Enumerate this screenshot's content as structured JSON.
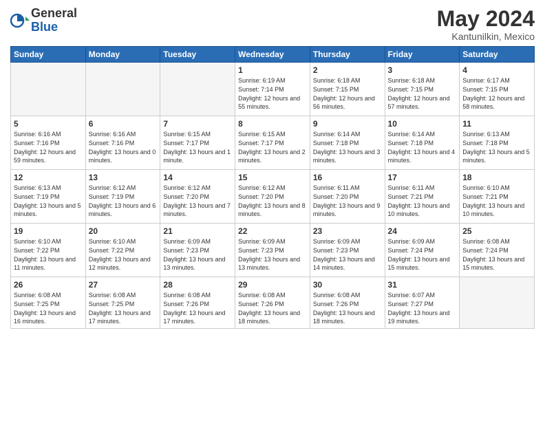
{
  "header": {
    "logo_general": "General",
    "logo_blue": "Blue",
    "title": "May 2024",
    "subtitle": "Kantunilkin, Mexico"
  },
  "weekdays": [
    "Sunday",
    "Monday",
    "Tuesday",
    "Wednesday",
    "Thursday",
    "Friday",
    "Saturday"
  ],
  "weeks": [
    [
      {
        "day": "",
        "empty": true
      },
      {
        "day": "",
        "empty": true
      },
      {
        "day": "",
        "empty": true
      },
      {
        "day": "1",
        "sunrise": "6:19 AM",
        "sunset": "7:14 PM",
        "daylight": "12 hours and 55 minutes."
      },
      {
        "day": "2",
        "sunrise": "6:18 AM",
        "sunset": "7:15 PM",
        "daylight": "12 hours and 56 minutes."
      },
      {
        "day": "3",
        "sunrise": "6:18 AM",
        "sunset": "7:15 PM",
        "daylight": "12 hours and 57 minutes."
      },
      {
        "day": "4",
        "sunrise": "6:17 AM",
        "sunset": "7:15 PM",
        "daylight": "12 hours and 58 minutes."
      }
    ],
    [
      {
        "day": "5",
        "sunrise": "6:16 AM",
        "sunset": "7:16 PM",
        "daylight": "12 hours and 59 minutes."
      },
      {
        "day": "6",
        "sunrise": "6:16 AM",
        "sunset": "7:16 PM",
        "daylight": "13 hours and 0 minutes."
      },
      {
        "day": "7",
        "sunrise": "6:15 AM",
        "sunset": "7:17 PM",
        "daylight": "13 hours and 1 minute."
      },
      {
        "day": "8",
        "sunrise": "6:15 AM",
        "sunset": "7:17 PM",
        "daylight": "13 hours and 2 minutes."
      },
      {
        "day": "9",
        "sunrise": "6:14 AM",
        "sunset": "7:18 PM",
        "daylight": "13 hours and 3 minutes."
      },
      {
        "day": "10",
        "sunrise": "6:14 AM",
        "sunset": "7:18 PM",
        "daylight": "13 hours and 4 minutes."
      },
      {
        "day": "11",
        "sunrise": "6:13 AM",
        "sunset": "7:18 PM",
        "daylight": "13 hours and 5 minutes."
      }
    ],
    [
      {
        "day": "12",
        "sunrise": "6:13 AM",
        "sunset": "7:19 PM",
        "daylight": "13 hours and 5 minutes."
      },
      {
        "day": "13",
        "sunrise": "6:12 AM",
        "sunset": "7:19 PM",
        "daylight": "13 hours and 6 minutes."
      },
      {
        "day": "14",
        "sunrise": "6:12 AM",
        "sunset": "7:20 PM",
        "daylight": "13 hours and 7 minutes."
      },
      {
        "day": "15",
        "sunrise": "6:12 AM",
        "sunset": "7:20 PM",
        "daylight": "13 hours and 8 minutes."
      },
      {
        "day": "16",
        "sunrise": "6:11 AM",
        "sunset": "7:20 PM",
        "daylight": "13 hours and 9 minutes."
      },
      {
        "day": "17",
        "sunrise": "6:11 AM",
        "sunset": "7:21 PM",
        "daylight": "13 hours and 10 minutes."
      },
      {
        "day": "18",
        "sunrise": "6:10 AM",
        "sunset": "7:21 PM",
        "daylight": "13 hours and 10 minutes."
      }
    ],
    [
      {
        "day": "19",
        "sunrise": "6:10 AM",
        "sunset": "7:22 PM",
        "daylight": "13 hours and 11 minutes."
      },
      {
        "day": "20",
        "sunrise": "6:10 AM",
        "sunset": "7:22 PM",
        "daylight": "13 hours and 12 minutes."
      },
      {
        "day": "21",
        "sunrise": "6:09 AM",
        "sunset": "7:23 PM",
        "daylight": "13 hours and 13 minutes."
      },
      {
        "day": "22",
        "sunrise": "6:09 AM",
        "sunset": "7:23 PM",
        "daylight": "13 hours and 13 minutes."
      },
      {
        "day": "23",
        "sunrise": "6:09 AM",
        "sunset": "7:23 PM",
        "daylight": "13 hours and 14 minutes."
      },
      {
        "day": "24",
        "sunrise": "6:09 AM",
        "sunset": "7:24 PM",
        "daylight": "13 hours and 15 minutes."
      },
      {
        "day": "25",
        "sunrise": "6:08 AM",
        "sunset": "7:24 PM",
        "daylight": "13 hours and 15 minutes."
      }
    ],
    [
      {
        "day": "26",
        "sunrise": "6:08 AM",
        "sunset": "7:25 PM",
        "daylight": "13 hours and 16 minutes."
      },
      {
        "day": "27",
        "sunrise": "6:08 AM",
        "sunset": "7:25 PM",
        "daylight": "13 hours and 17 minutes."
      },
      {
        "day": "28",
        "sunrise": "6:08 AM",
        "sunset": "7:26 PM",
        "daylight": "13 hours and 17 minutes."
      },
      {
        "day": "29",
        "sunrise": "6:08 AM",
        "sunset": "7:26 PM",
        "daylight": "13 hours and 18 minutes."
      },
      {
        "day": "30",
        "sunrise": "6:08 AM",
        "sunset": "7:26 PM",
        "daylight": "13 hours and 18 minutes."
      },
      {
        "day": "31",
        "sunrise": "6:07 AM",
        "sunset": "7:27 PM",
        "daylight": "13 hours and 19 minutes."
      },
      {
        "day": "",
        "empty": true
      }
    ]
  ]
}
